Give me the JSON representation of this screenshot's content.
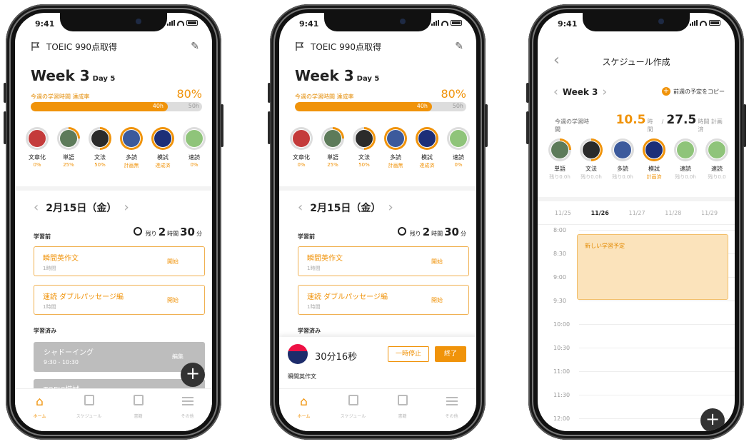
{
  "status": {
    "time": "9:41"
  },
  "home": {
    "goal_title": "TOEIC 990点取得",
    "week_label": "Week 3",
    "day_label": "Day 5",
    "rate_label": "今週の学習時間 達成率",
    "rate_percent": "80%",
    "progress_fraction": 0.8,
    "bar_done": "40h",
    "bar_total": "50h",
    "books": [
      {
        "name": "文章化",
        "status": "0%",
        "ring": "none",
        "color": "#c43b3b"
      },
      {
        "name": "単語",
        "status": "25%",
        "ring": "q",
        "color": "#5d7b5a"
      },
      {
        "name": "文法",
        "status": "50%",
        "ring": "h",
        "color": "#2b2b2b"
      },
      {
        "name": "多読",
        "status": "計画無",
        "ring": "o",
        "color": "#3c5a9c"
      },
      {
        "name": "模試",
        "status": "達成済",
        "ring": "o",
        "color": "#1d2f78"
      },
      {
        "name": "速読",
        "status": "0%",
        "ring": "none",
        "color": "#8fc47a"
      }
    ],
    "date_label": "2月15日（金）",
    "section_before": "学習前",
    "remain_prefix": "残り",
    "remain_hours": "2",
    "remain_hours_unit": "時間",
    "remain_minutes": "30",
    "remain_minutes_unit": "分",
    "tasks": [
      {
        "title": "瞬間英作文",
        "duration": "1時間",
        "action": "開始"
      },
      {
        "title": "速読 ダブルパッセージ編",
        "duration": "1時間",
        "action": "開始"
      }
    ],
    "section_done": "学習済み",
    "done_tasks": [
      {
        "title": "シャドーイング",
        "time": "9:30 - 10:30",
        "action": "編集"
      },
      {
        "title": "TOEIC模試",
        "time": "",
        "action": "編集"
      }
    ]
  },
  "tabs": [
    {
      "label": "ホーム",
      "icon": "home-icon"
    },
    {
      "label": "スケジュール",
      "icon": "calendar-icon"
    },
    {
      "label": "書籍",
      "icon": "book-icon"
    },
    {
      "label": "その他",
      "icon": "menu-icon"
    }
  ],
  "player": {
    "elapsed": "30分16秒",
    "pause_label": "一時停止",
    "end_label": "終了",
    "task_name": "瞬間英作文"
  },
  "schedule": {
    "title": "スケジュール作成",
    "week_label": "Week 3",
    "copy_label": "前週の予定をコピー",
    "hours_label": "今週の学習時間",
    "hours_done": "10.5",
    "hours_unit": "時間",
    "hours_sep": "/",
    "hours_planned": "27.5",
    "hours_planned_suffix": "時間 計画済",
    "books": [
      {
        "name": "単語",
        "status": "残り0.0h",
        "ring": "q",
        "color": "#5d7b5a"
      },
      {
        "name": "文法",
        "status": "残り0.0h",
        "ring": "h",
        "color": "#2b2b2b"
      },
      {
        "name": "多読",
        "status": "残り0.0h",
        "ring": "none",
        "color": "#3c5a9c"
      },
      {
        "name": "模試",
        "status": "計画済",
        "ring": "o",
        "color": "#1d2f78"
      },
      {
        "name": "速読",
        "status": "残り0.0h",
        "ring": "none",
        "color": "#8fc47a"
      },
      {
        "name": "速読",
        "status": "残り0.0",
        "ring": "none",
        "color": "#8fc47a"
      }
    ],
    "days": [
      "11/25",
      "11/26",
      "11/27",
      "11/28",
      "11/29"
    ],
    "active_day": 1,
    "times": [
      "8:00",
      "8:30",
      "9:00",
      "9:30",
      "10:00",
      "10:30",
      "11:00",
      "11:30",
      "12:00"
    ],
    "event_title": "新しい学習予定"
  }
}
